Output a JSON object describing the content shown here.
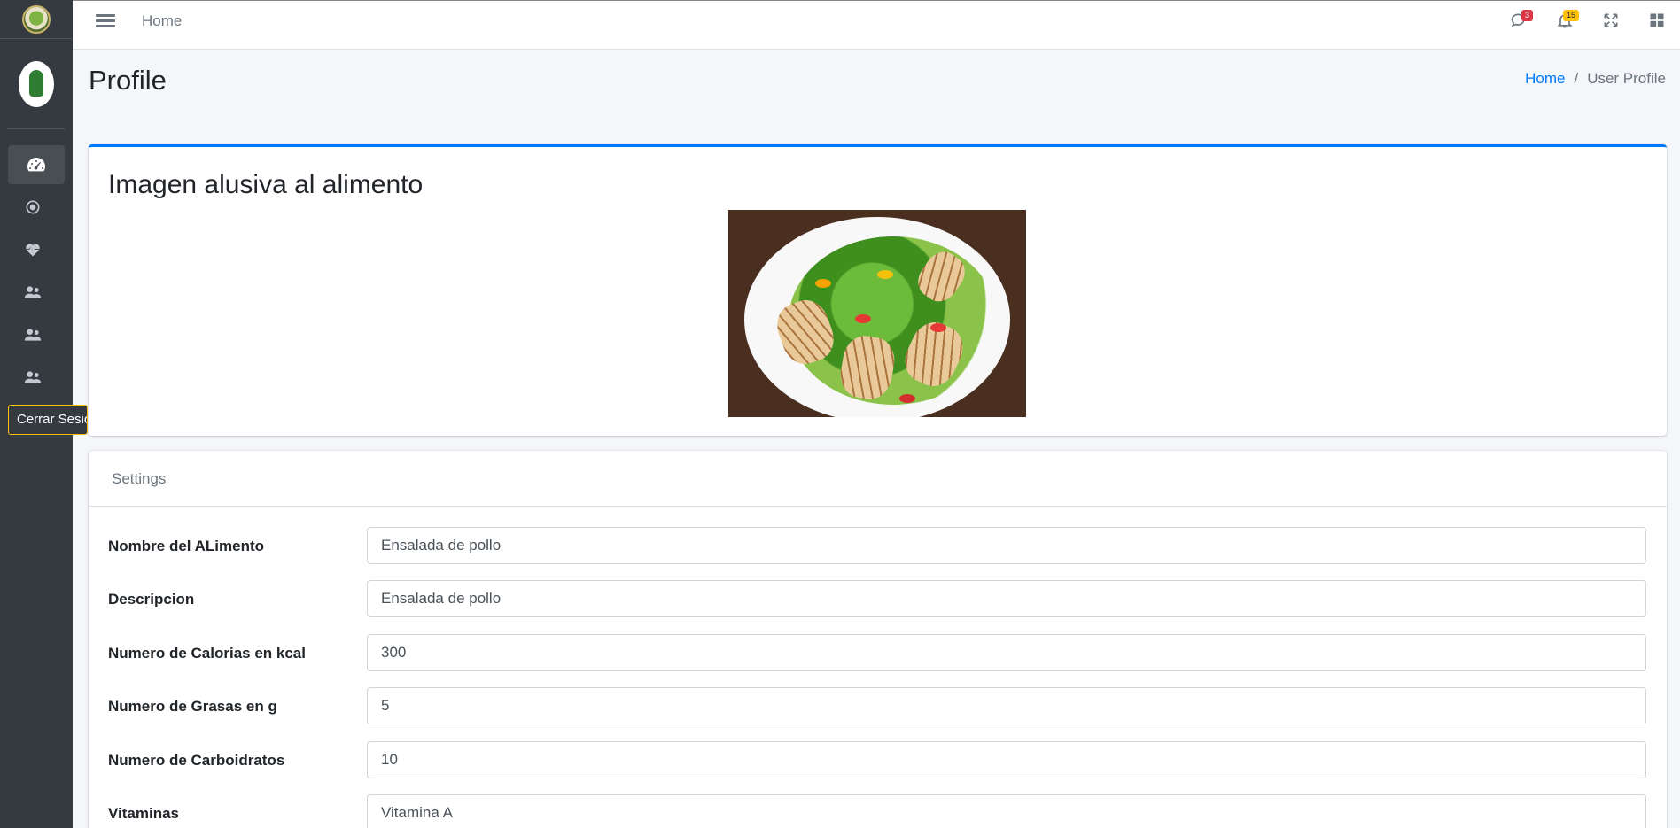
{
  "topbar": {
    "home_label": "Home",
    "messages_badge": "3",
    "notifications_badge": "15"
  },
  "sidebar": {
    "logout_label": "Cerrar Sesión",
    "items": [
      {
        "icon": "tachometer-icon",
        "active": true
      },
      {
        "icon": "circle-dot-icon"
      },
      {
        "icon": "heartbeat-icon"
      },
      {
        "icon": "users-icon"
      },
      {
        "icon": "users-icon"
      },
      {
        "icon": "users-icon"
      }
    ]
  },
  "header": {
    "title": "Profile",
    "breadcrumb": {
      "home": "Home",
      "separator": "/",
      "current": "User Profile"
    }
  },
  "image_card": {
    "title": "Imagen alusiva al alimento"
  },
  "settings": {
    "title": "Settings",
    "fields": [
      {
        "label": "Nombre del ALimento",
        "value": "Ensalada de pollo"
      },
      {
        "label": "Descripcion",
        "value": "Ensalada de pollo"
      },
      {
        "label": "Numero de Calorias en kcal",
        "value": "300"
      },
      {
        "label": "Numero de Grasas en g",
        "value": "5"
      },
      {
        "label": "Numero de Carboidratos",
        "value": "10"
      },
      {
        "label": "Vitaminas",
        "value": "Vitamina A"
      }
    ]
  },
  "colors": {
    "sidebar_bg": "#343a40",
    "accent": "#007bff",
    "logout_border": "#ffc107",
    "badge_red": "#dc3545",
    "badge_yellow": "#ffc107"
  }
}
